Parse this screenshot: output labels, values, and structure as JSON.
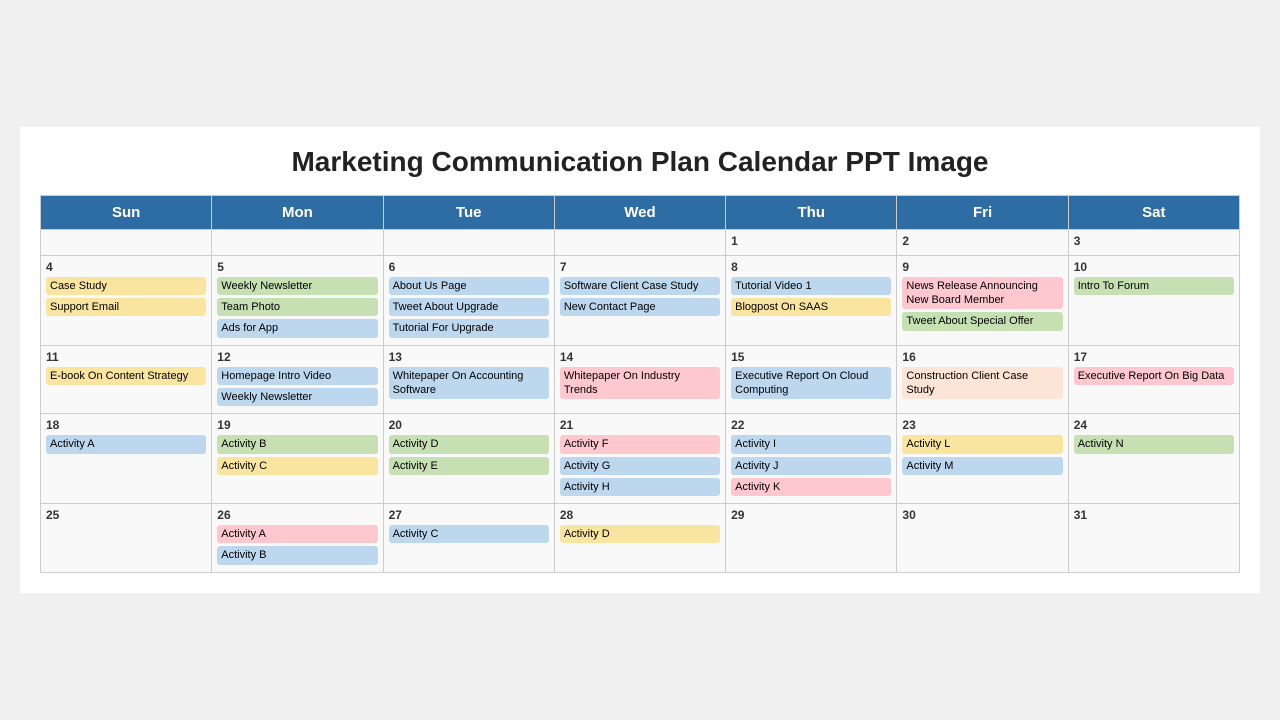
{
  "title": "Marketing Communication Plan Calendar PPT Image",
  "headers": [
    "Sun",
    "Mon",
    "Tue",
    "Wed",
    "Thu",
    "Fri",
    "Sat"
  ],
  "rows": [
    {
      "week": "row1",
      "days": [
        {
          "num": "",
          "events": []
        },
        {
          "num": "",
          "events": []
        },
        {
          "num": "",
          "events": []
        },
        {
          "num": "",
          "events": []
        },
        {
          "num": "1",
          "events": []
        },
        {
          "num": "2",
          "events": []
        },
        {
          "num": "3",
          "events": []
        }
      ]
    },
    {
      "week": "row2",
      "days": [
        {
          "num": "4",
          "events": [
            {
              "label": "Case Study",
              "color": "yellow"
            },
            {
              "label": "Support Email",
              "color": "yellow"
            }
          ]
        },
        {
          "num": "5",
          "events": [
            {
              "label": "Weekly Newsletter",
              "color": "green"
            },
            {
              "label": "Team Photo",
              "color": "green"
            },
            {
              "label": "Ads for App",
              "color": "blue"
            }
          ]
        },
        {
          "num": "6",
          "events": [
            {
              "label": "About Us Page",
              "color": "blue"
            },
            {
              "label": "Tweet About Upgrade",
              "color": "blue"
            },
            {
              "label": "Tutorial For Upgrade",
              "color": "blue"
            }
          ]
        },
        {
          "num": "7",
          "events": [
            {
              "label": "Software Client Case Study",
              "color": "blue"
            },
            {
              "label": "New Contact Page",
              "color": "blue"
            }
          ]
        },
        {
          "num": "8",
          "events": [
            {
              "label": "Tutorial Video 1",
              "color": "blue"
            },
            {
              "label": "Blogpost On SAAS",
              "color": "yellow"
            }
          ]
        },
        {
          "num": "9",
          "events": [
            {
              "label": "News Release Announcing New Board Member",
              "color": "pink"
            },
            {
              "label": "Tweet About Special Offer",
              "color": "green"
            }
          ]
        },
        {
          "num": "10",
          "events": [
            {
              "label": "Intro To Forum",
              "color": "green"
            }
          ]
        }
      ]
    },
    {
      "week": "row3",
      "days": [
        {
          "num": "11",
          "events": [
            {
              "label": "E-book On Content Strategy",
              "color": "yellow"
            }
          ]
        },
        {
          "num": "12",
          "events": [
            {
              "label": "Homepage Intro Video",
              "color": "blue"
            },
            {
              "label": "Weekly Newsletter",
              "color": "blue"
            }
          ]
        },
        {
          "num": "13",
          "events": [
            {
              "label": "Whitepaper On Accounting Software",
              "color": "blue"
            }
          ]
        },
        {
          "num": "14",
          "events": [
            {
              "label": "Whitepaper On Industry Trends",
              "color": "pink"
            }
          ]
        },
        {
          "num": "15",
          "events": [
            {
              "label": "Executive Report On Cloud Computing",
              "color": "blue"
            }
          ]
        },
        {
          "num": "16",
          "events": [
            {
              "label": "Construction Client Case Study",
              "color": "orange"
            }
          ]
        },
        {
          "num": "17",
          "events": [
            {
              "label": "Executive Report On Big Data",
              "color": "pink"
            }
          ]
        }
      ]
    },
    {
      "week": "row4",
      "days": [
        {
          "num": "18",
          "events": [
            {
              "label": "Activity A",
              "color": "blue"
            }
          ]
        },
        {
          "num": "19",
          "events": [
            {
              "label": "Activity B",
              "color": "green"
            },
            {
              "label": "Activity C",
              "color": "yellow"
            }
          ]
        },
        {
          "num": "20",
          "events": [
            {
              "label": "Activity D",
              "color": "green"
            },
            {
              "label": "Activity E",
              "color": "green"
            }
          ]
        },
        {
          "num": "21",
          "events": [
            {
              "label": "Activity F",
              "color": "pink"
            },
            {
              "label": "Activity G",
              "color": "blue"
            },
            {
              "label": "Activity H",
              "color": "blue"
            }
          ]
        },
        {
          "num": "22",
          "events": [
            {
              "label": "Activity I",
              "color": "blue"
            },
            {
              "label": "Activity J",
              "color": "blue"
            },
            {
              "label": "Activity K",
              "color": "pink"
            }
          ]
        },
        {
          "num": "23",
          "events": [
            {
              "label": "Activity L",
              "color": "yellow"
            },
            {
              "label": "Activity M",
              "color": "blue"
            }
          ]
        },
        {
          "num": "24",
          "events": [
            {
              "label": "Activity N",
              "color": "green"
            }
          ]
        }
      ]
    },
    {
      "week": "row5",
      "days": [
        {
          "num": "25",
          "events": []
        },
        {
          "num": "26",
          "events": [
            {
              "label": "Activity A",
              "color": "pink"
            },
            {
              "label": "Activity B",
              "color": "blue"
            }
          ]
        },
        {
          "num": "27",
          "events": [
            {
              "label": "Activity C",
              "color": "blue"
            }
          ]
        },
        {
          "num": "28",
          "events": [
            {
              "label": "Activity D",
              "color": "yellow"
            }
          ]
        },
        {
          "num": "29",
          "events": []
        },
        {
          "num": "30",
          "events": []
        },
        {
          "num": "31",
          "events": []
        }
      ]
    }
  ]
}
